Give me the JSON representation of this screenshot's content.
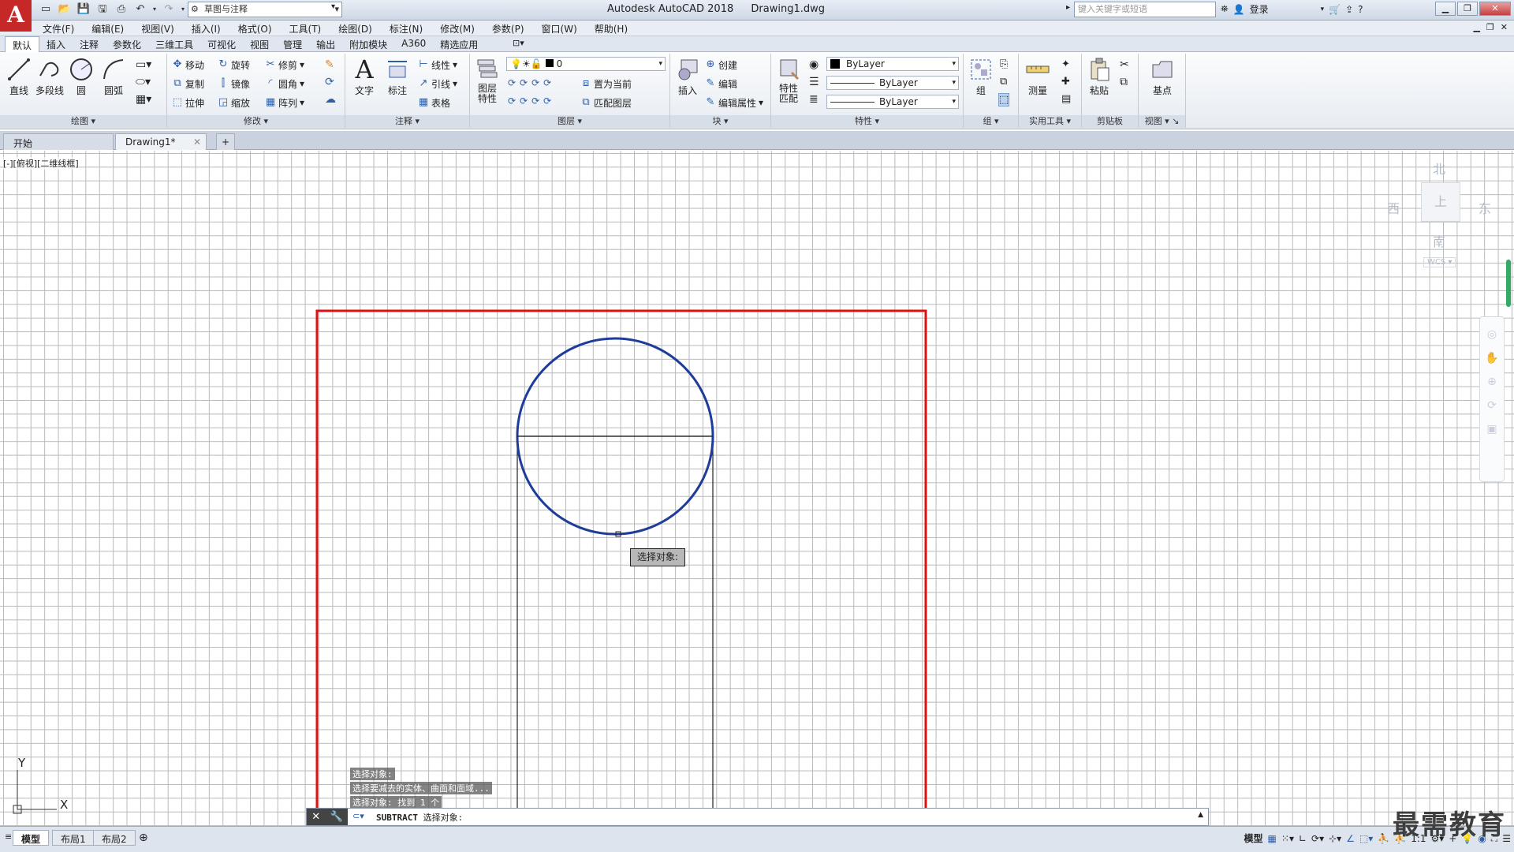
{
  "app": {
    "logo": "A",
    "title": "Autodesk AutoCAD 2018",
    "document": "Drawing1.dwg",
    "workspace": "草图与注释",
    "search_placeholder": "键入关键字或短语",
    "login": "登录"
  },
  "menu": [
    "文件(F)",
    "编辑(E)",
    "视图(V)",
    "插入(I)",
    "格式(O)",
    "工具(T)",
    "绘图(D)",
    "标注(N)",
    "修改(M)",
    "参数(P)",
    "窗口(W)",
    "帮助(H)"
  ],
  "ribbon_tabs": [
    "默认",
    "插入",
    "注释",
    "参数化",
    "三维工具",
    "可视化",
    "视图",
    "管理",
    "输出",
    "附加模块",
    "A360",
    "精选应用"
  ],
  "ribbon": {
    "draw": {
      "title": "绘图",
      "line": "直线",
      "polyline": "多段线",
      "circle": "圆",
      "arc": "圆弧"
    },
    "modify": {
      "title": "修改",
      "move": "移动",
      "rotate": "旋转",
      "trim": "修剪",
      "copy": "复制",
      "mirror": "镜像",
      "fillet": "圆角",
      "stretch": "拉伸",
      "scale": "缩放",
      "array": "阵列"
    },
    "annotation": {
      "title": "注释",
      "text": "文字",
      "dimension": "标注",
      "linear": "线性",
      "leader": "引线",
      "table": "表格"
    },
    "layers": {
      "title": "图层",
      "properties": "图层\n特性",
      "current_layer": "0",
      "set_current": "置为当前",
      "match_layer": "匹配图层"
    },
    "block": {
      "title": "块",
      "insert": "插入",
      "create": "创建",
      "edit": "编辑",
      "edit_attr": "编辑属性"
    },
    "properties": {
      "title": "特性",
      "match": "特性\n匹配",
      "color": "ByLayer",
      "linetype": "ByLayer",
      "lineweight": "ByLayer"
    },
    "groups": {
      "title": "组",
      "group": "组"
    },
    "utilities": {
      "title": "实用工具",
      "measure": "测量"
    },
    "clipboard": {
      "title": "剪贴板",
      "paste": "粘贴"
    },
    "view": {
      "title": "视图",
      "base": "基点"
    }
  },
  "file_tabs": {
    "start": "开始",
    "drawing": "Drawing1*",
    "add": "+"
  },
  "viewport_label": "[-][俯视][二维线框]",
  "viewcube": {
    "north": "北",
    "south": "南",
    "east": "东",
    "west": "西",
    "top": "上",
    "wcs": "WCS"
  },
  "ucs": {
    "x": "X",
    "y": "Y"
  },
  "tooltip": "选择对象:",
  "command_history": [
    "选择对象:",
    "选择要减去的实体、曲面和面域...",
    "选择对象: 找到 1 个"
  ],
  "command_prompt": {
    "command": "SUBTRACT",
    "text": "选择对象:"
  },
  "layout_tabs": [
    "模型",
    "布局1",
    "布局2"
  ],
  "status": {
    "model": "模型",
    "scale": "1:1"
  },
  "watermark": "最需教育",
  "colors": {
    "highlight_red": "#e01010",
    "selection_blue": "#1e3c9a",
    "logo_red": "#c62828"
  }
}
